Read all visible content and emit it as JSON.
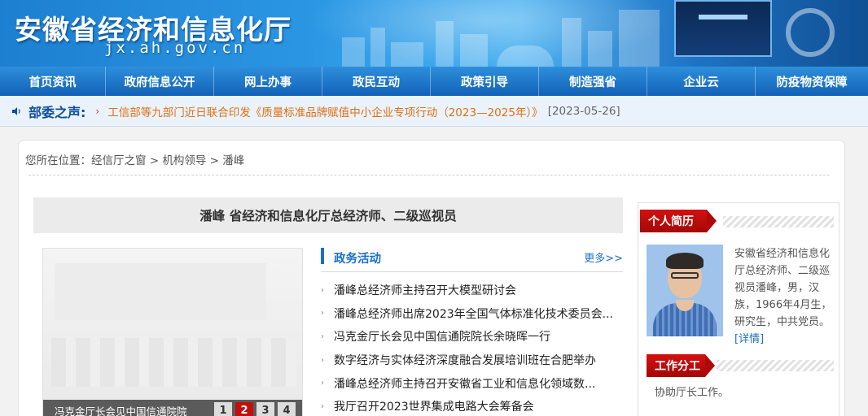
{
  "header": {
    "title": "安徽省经济和信息化厅",
    "domain": "jx.ah.gov.cn"
  },
  "nav": {
    "items": [
      {
        "label": "首页资讯",
        "width": 130
      },
      {
        "label": "政府信息公开",
        "width": 133
      },
      {
        "label": "网上办事",
        "width": 133
      },
      {
        "label": "政民互动",
        "width": 133
      },
      {
        "label": "政策引导",
        "width": 133
      },
      {
        "label": "制造强省",
        "width": 133
      },
      {
        "label": "企业云",
        "width": 133
      },
      {
        "label": "防疫物资保障",
        "width": 138
      }
    ]
  },
  "ticker": {
    "label": "部委之声:",
    "text": "工信部等九部门近日联合印发《质量标准品牌赋值中小企业专项行动（2023—2025年）》",
    "date": "[2023-05-26]"
  },
  "breadcrumb": {
    "text": "您所在位置：经信厅之窗 > 机构领导 > 潘峰"
  },
  "leader": {
    "title": "潘峰 省经济和信息化厅总经济师、二级巡视员"
  },
  "slideshow": {
    "caption": "冯克金厅长会见中国信通院院",
    "pages": [
      "1",
      "2",
      "3",
      "4"
    ],
    "active_page": 2
  },
  "news": {
    "title": "政务活动",
    "more": "更多>>",
    "items": [
      "潘峰总经济师主持召开大模型研讨会",
      "潘峰总经济师出席2023年全国气体标准化技术委员会...",
      "冯克金厅长会见中国信通院院长余晓晖一行",
      "数字经济与实体经济深度融合发展培训班在合肥举办",
      "潘峰总经济师主持召开安徽省工业和信息化领域数...",
      "我厅召开2023世界集成电路大会筹备会"
    ]
  },
  "profile": {
    "bio_heading": "个人简历",
    "bio": "安徽省经济和信息化厅总经济师、二级巡视员潘峰，男，汉族，1966年4月生，研究生，中共党员。",
    "detail_link": "[详情]",
    "duty_heading": "工作分工",
    "duty": "协助厅长工作。"
  },
  "colors": {
    "nav_bg": "#1a72c6",
    "accent_blue": "#1a6fc8",
    "accent_red": "#c40d0d",
    "ticker_text": "#e07012"
  },
  "icons": {
    "ticker": "speaker-icon",
    "bullet": "chevron-right-icon"
  }
}
